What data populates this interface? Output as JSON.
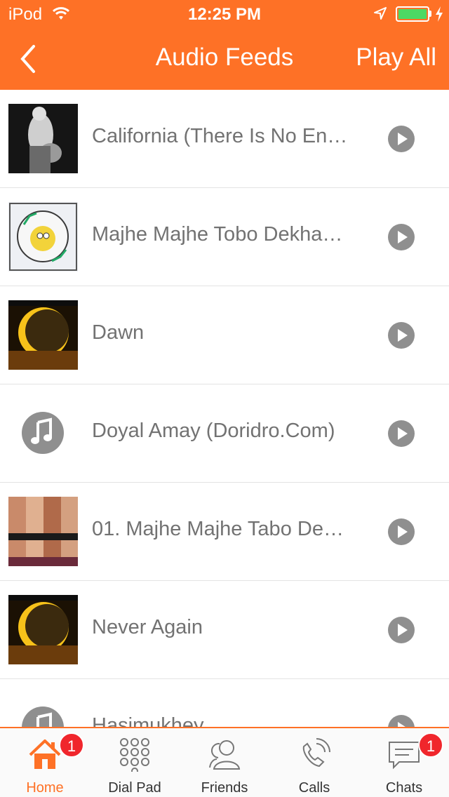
{
  "status_bar": {
    "carrier": "iPod",
    "time": "12:25 PM",
    "battery_level": 1.0
  },
  "nav": {
    "title": "Audio Feeds",
    "play_all_label": "Play All"
  },
  "feeds": [
    {
      "title": "California (There Is No En…",
      "artwork": "bw-photo"
    },
    {
      "title": "Majhe Majhe Tobo Dekha…",
      "artwork": "doridro-logo"
    },
    {
      "title": "Dawn",
      "artwork": "eclipse-art"
    },
    {
      "title": " Doyal Amay (Doridro.Com)",
      "artwork": "music-note-icon"
    },
    {
      "title": "01. Majhe Majhe Tabo De…",
      "artwork": "collage-art"
    },
    {
      "title": "Never Again",
      "artwork": "eclipse-art"
    },
    {
      "title": "Hasimukhey",
      "artwork": "music-note-icon"
    }
  ],
  "tabs": [
    {
      "label": "Home",
      "icon": "home-icon",
      "active": true,
      "badge": "1"
    },
    {
      "label": "Dial Pad",
      "icon": "dialpad-icon",
      "active": false
    },
    {
      "label": "Friends",
      "icon": "friends-icon",
      "active": false
    },
    {
      "label": "Calls",
      "icon": "phone-icon",
      "active": false
    },
    {
      "label": "Chats",
      "icon": "chat-icon",
      "active": false,
      "badge": "1"
    }
  ],
  "colors": {
    "brand": "#fe7126",
    "badge": "#f0262c",
    "text_gray": "#727272",
    "battery": "#4cd964"
  }
}
